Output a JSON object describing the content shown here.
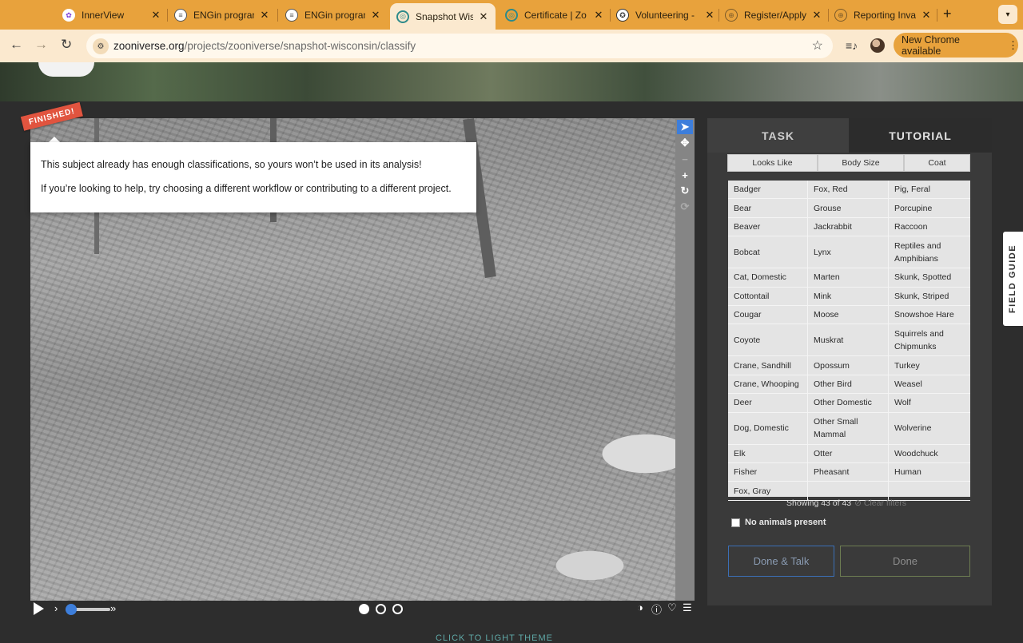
{
  "browser": {
    "tabs": [
      {
        "title": "InnerView",
        "icon": "innerview-icon"
      },
      {
        "title": "ENGin program",
        "icon": "chat-icon"
      },
      {
        "title": "ENGin program",
        "icon": "chat-icon"
      },
      {
        "title": "Snapshot Wisc",
        "icon": "zooniverse-icon",
        "active": true
      },
      {
        "title": "Certificate | Zo",
        "icon": "zooniverse-icon"
      },
      {
        "title": "Volunteering -",
        "icon": "seal-icon"
      },
      {
        "title": "Register/Apply",
        "icon": "globe-icon"
      },
      {
        "title": "Reporting Inva",
        "icon": "globe-icon"
      }
    ],
    "url_host": "zooniverse.org",
    "url_path": "/projects/zooniverse/snapshot-wisconsin/classify",
    "update_label": "New Chrome available"
  },
  "subject": {
    "finished_label": "FINISHED!",
    "tooltip_line1": "This subject already has enough classifications, so yours won’t be used in its analysis!",
    "tooltip_line2": "If you’re looking to help, try choosing a different workflow or contributing to a different project."
  },
  "panel": {
    "tab_task": "TASK",
    "tab_tutorial": "TUTORIAL",
    "filters": [
      "Looks Like",
      "Body Size",
      "Coat"
    ],
    "species_rows": [
      [
        "Badger",
        "Fox, Red",
        "Pig, Feral"
      ],
      [
        "Bear",
        "Grouse",
        "Porcupine"
      ],
      [
        "Beaver",
        "Jackrabbit",
        "Raccoon"
      ],
      [
        "Bobcat",
        "Lynx",
        "Reptiles and Amphibians"
      ],
      [
        "Cat, Domestic",
        "Marten",
        "Skunk, Spotted"
      ],
      [
        "Cottontail",
        "Mink",
        "Skunk, Striped"
      ],
      [
        "Cougar",
        "Moose",
        "Snowshoe Hare"
      ],
      [
        "Coyote",
        "Muskrat",
        "Squirrels and Chipmunks"
      ],
      [
        "Crane, Sandhill",
        "Opossum",
        "Turkey"
      ],
      [
        "Crane, Whooping",
        "Other Bird",
        "Weasel"
      ],
      [
        "Deer",
        "Other Domestic",
        "Wolf"
      ],
      [
        "Dog, Domestic",
        "Other Small Mammal",
        "Wolverine"
      ],
      [
        "Elk",
        "Otter",
        "Woodchuck"
      ],
      [
        "Fisher",
        "Pheasant",
        "Human"
      ],
      [
        "Fox, Gray",
        "",
        ""
      ]
    ],
    "showing": "Showing 43 of 43",
    "clear_filters": "Clear filters",
    "no_animals": "No animals present",
    "done_talk": "Done & Talk",
    "done": "Done"
  },
  "field_guide": "FIELD GUIDE",
  "footer": "CLICK TO LIGHT THEME"
}
